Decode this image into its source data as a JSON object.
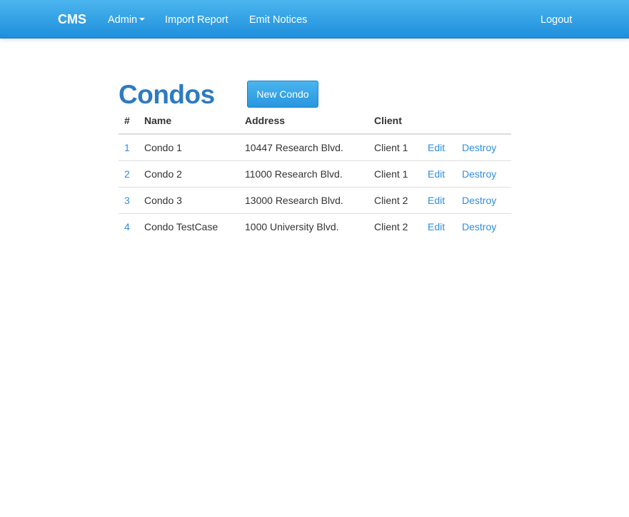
{
  "navbar": {
    "brand": "CMS",
    "items": [
      {
        "label": "Admin",
        "has_dropdown": true
      },
      {
        "label": "Import Report"
      },
      {
        "label": "Emit Notices"
      }
    ],
    "logout": "Logout"
  },
  "main": {
    "title": "Condos",
    "new_button": "New Condo",
    "table": {
      "headers": {
        "num": "#",
        "name": "Name",
        "address": "Address",
        "client": "Client"
      },
      "rows": [
        {
          "num": "1",
          "name": "Condo 1",
          "address": "10447 Research Blvd.",
          "client": "Client 1",
          "edit": "Edit",
          "destroy": "Destroy"
        },
        {
          "num": "2",
          "name": "Condo 2",
          "address": "11000 Research Blvd.",
          "client": "Client 1",
          "edit": "Edit",
          "destroy": "Destroy"
        },
        {
          "num": "3",
          "name": "Condo 3",
          "address": "13000 Research Blvd.",
          "client": "Client 2",
          "edit": "Edit",
          "destroy": "Destroy"
        },
        {
          "num": "4",
          "name": "Condo TestCase",
          "address": "1000 University Blvd.",
          "client": "Client 2",
          "edit": "Edit",
          "destroy": "Destroy"
        }
      ]
    }
  },
  "colors": {
    "navbar_top": "#4ab5ee",
    "navbar_bottom": "#1f8fdb",
    "title": "#2d7bc0",
    "link": "#2d8ee0"
  }
}
